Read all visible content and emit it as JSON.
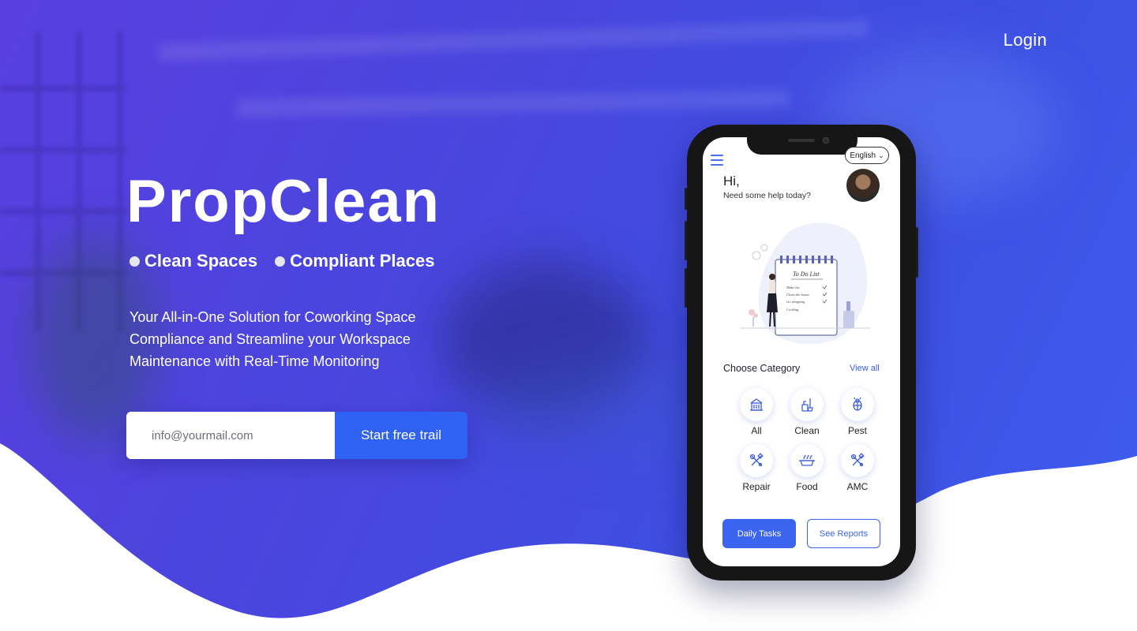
{
  "nav": {
    "login_label": "Login"
  },
  "hero": {
    "title": "PropClean",
    "taglines": [
      "Clean Spaces",
      "Compliant Places"
    ],
    "description": "Your All-in-One Solution for Coworking Space Compliance and Streamline  your Workspace Maintenance with Real-Time Monitoring",
    "email_placeholder": "info@yourmail.com",
    "cta_label": "Start free trail"
  },
  "app": {
    "language": "English",
    "greeting": "Hi,",
    "greeting_sub": "Need some help today?",
    "illustration_title": "To Do List",
    "illustration_items": [
      "Make list",
      "Clean the house",
      "Go shopping",
      "Cooking"
    ],
    "section_title": "Choose Category",
    "view_all_label": "View all",
    "categories": [
      {
        "label": "All",
        "icon": "building-icon"
      },
      {
        "label": "Clean",
        "icon": "cleaning-icon"
      },
      {
        "label": "Pest",
        "icon": "bug-icon"
      },
      {
        "label": "Repair",
        "icon": "tools-icon"
      },
      {
        "label": "Food",
        "icon": "food-icon"
      },
      {
        "label": "AMC",
        "icon": "tools-icon"
      }
    ],
    "primary_button": "Daily Tasks",
    "secondary_button": "See Reports"
  },
  "colors": {
    "hero_gradient_start": "#5a3fe0",
    "hero_gradient_end": "#3f5df0",
    "accent_blue": "#2f62f3",
    "app_accent": "#3b64f0"
  }
}
